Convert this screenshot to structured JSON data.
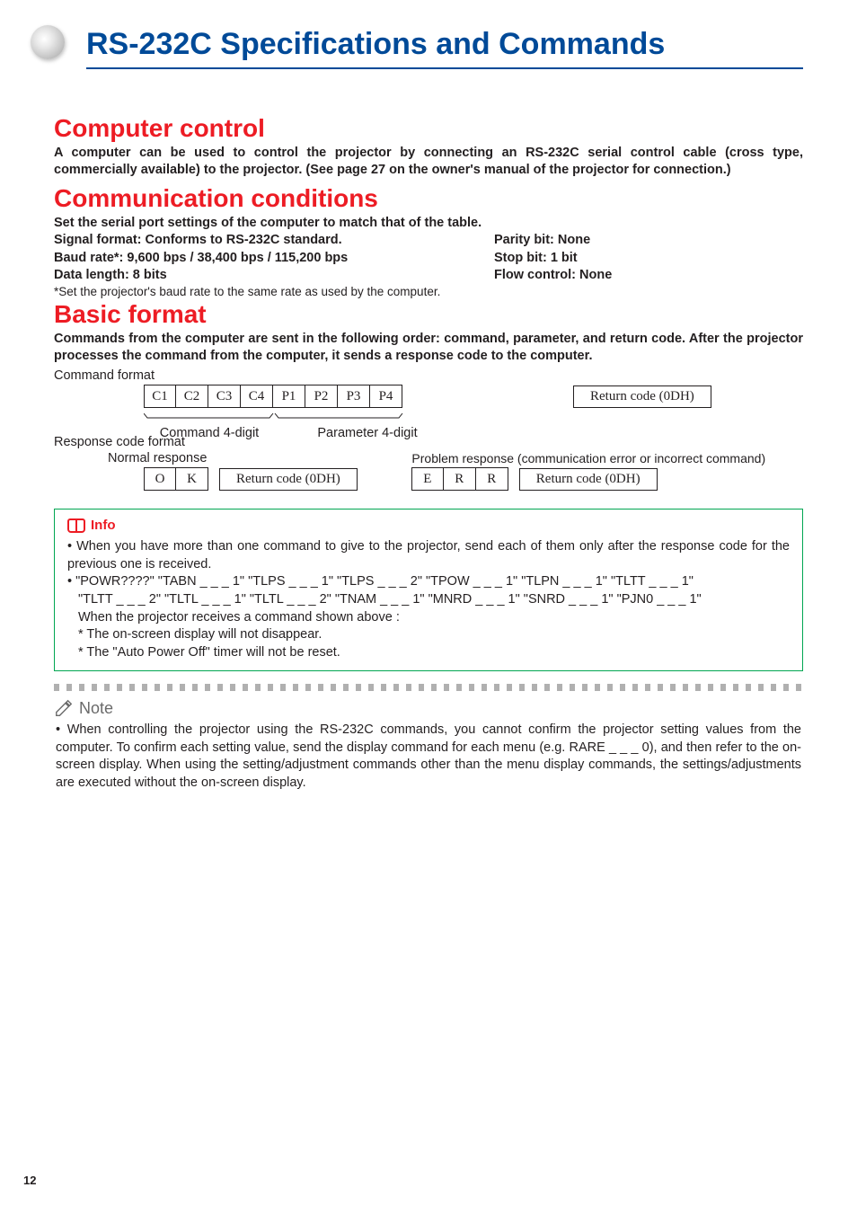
{
  "page": {
    "main_title": "RS-232C Specifications and Commands",
    "number": "12"
  },
  "sec1": {
    "heading": "Computer control",
    "body": "A computer can be used to control the projector by connecting an RS-232C serial control cable (cross type, commercially available) to the projector. (See page 27 on the owner's manual of the projector for connection.)"
  },
  "sec2": {
    "heading": "Communication conditions",
    "intro": "Set the serial port settings of the computer to match that of the table.",
    "left1": "Signal format: Conforms to RS-232C standard.",
    "right1": "Parity bit: None",
    "left2": "Baud rate*: 9,600 bps / 38,400 bps / 115,200 bps",
    "right2": "Stop bit: 1 bit",
    "left3": "Data length: 8 bits",
    "right3": "Flow control: None",
    "footnote": "*Set the projector's baud rate to the same rate as used by the computer."
  },
  "sec3": {
    "heading": "Basic format",
    "body": "Commands from the computer are sent in the following order: command, parameter, and return code. After the projector processes the command from the computer, it sends a response code to the computer.",
    "command_format_label": "Command format",
    "cells": {
      "c1": "C1",
      "c2": "C2",
      "c3": "C3",
      "c4": "C4",
      "p1": "P1",
      "p2": "P2",
      "p3": "P3",
      "p4": "P4"
    },
    "return_code": "Return code (0DH)",
    "cmd4": "Command 4-digit",
    "param4": "Parameter 4-digit",
    "response_format_label": "Response code format",
    "normal_response_label": "Normal response",
    "problem_response_label": "Problem response (communication error or incorrect command)",
    "ok": {
      "o": "O",
      "k": "K"
    },
    "err": {
      "e": "E",
      "r1": "R",
      "r2": "R"
    }
  },
  "info": {
    "title": "Info",
    "bullet1": "When you have more than one command to give to the projector, send each of them only after the response code for the previous one is received.",
    "bullet2_line1": "\"POWR????\" \"TABN _ _ _ 1\" \"TLPS _ _ _ 1\" \"TLPS _ _ _ 2\" \"TPOW _ _ _ 1\" \"TLPN _ _ _ 1\" \"TLTT _ _ _ 1\"",
    "bullet2_line2": "\"TLTT _ _ _ 2\" \"TLTL _ _ _ 1\" \"TLTL _ _ _ 2\" \"TNAM _ _ _ 1\" \"MNRD _ _ _ 1\" \"SNRD _ _ _ 1\" \"PJN0 _ _ _ 1\"",
    "line3": "When the projector receives a command shown above :",
    "star1": "* The on-screen display will not disappear.",
    "star2": "* The \"Auto Power Off\" timer will not be reset."
  },
  "note": {
    "title": "Note",
    "body": "When controlling the projector using the RS-232C commands, you cannot confirm the projector setting values from the computer. To confirm each setting value, send the display command for each menu (e.g. RARE _ _ _ 0), and then refer to the on-screen display. When using the setting/adjustment commands other than the menu display commands, the settings/adjustments are executed without the on-screen display."
  }
}
